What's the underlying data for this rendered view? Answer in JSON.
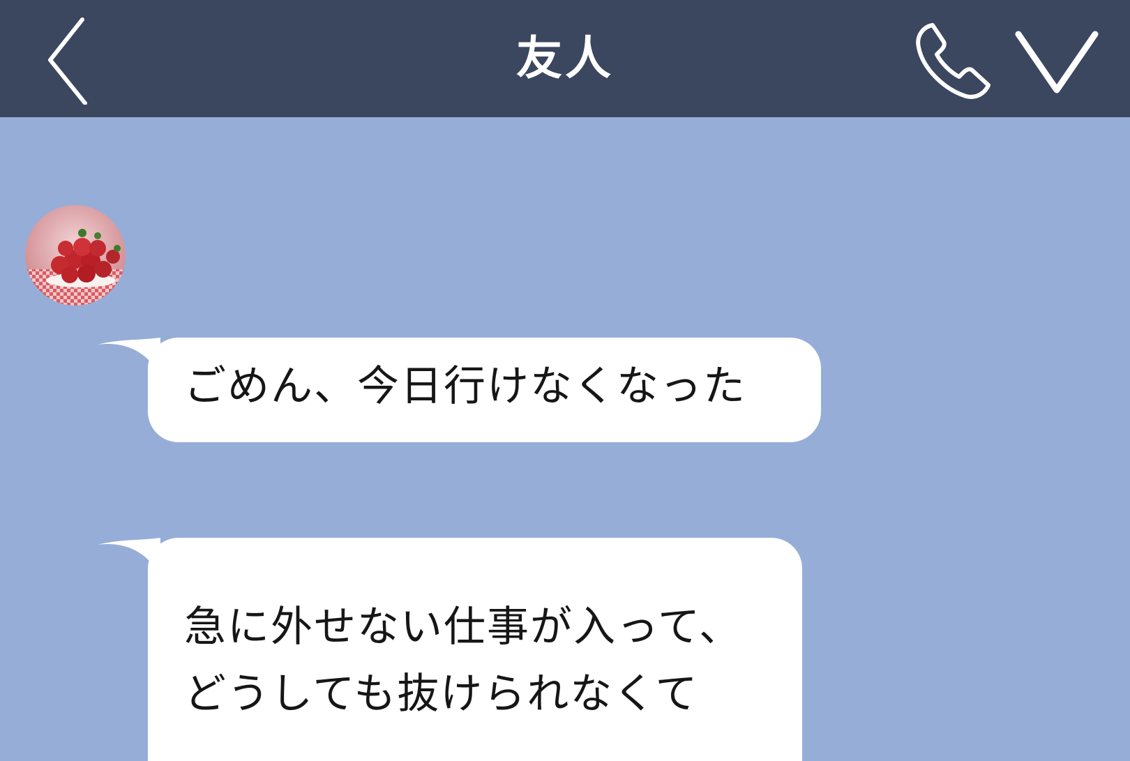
{
  "header": {
    "title": "友人",
    "back_icon": "chevron-left-icon",
    "call_icon": "phone-icon",
    "menu_icon": "chevron-down-icon",
    "background_color": "#3b465f"
  },
  "chat": {
    "background_color": "#96aed7",
    "contact_avatar": "strawberry-avatar",
    "messages": [
      {
        "sender": "friend",
        "lines": [
          "ごめん、今日行けなくなった"
        ]
      },
      {
        "sender": "friend",
        "lines": [
          "急に外せない仕事が入って、",
          "どうしても抜けられなくて"
        ]
      }
    ]
  }
}
